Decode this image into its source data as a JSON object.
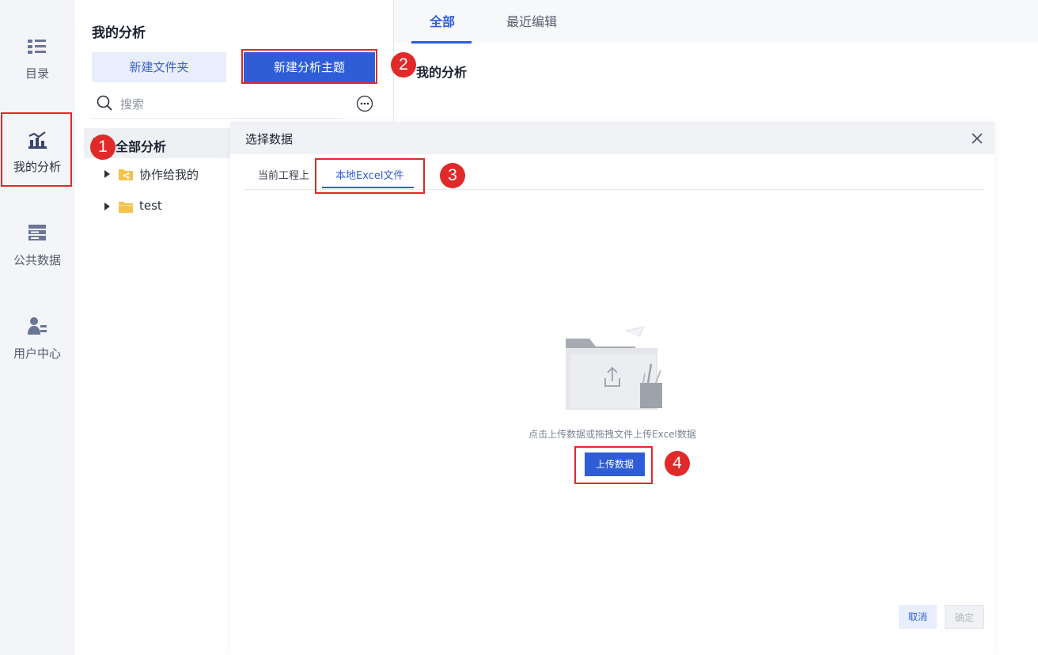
{
  "nav": {
    "items": [
      {
        "label": "目录",
        "icon": "catalog-icon"
      },
      {
        "label": "我的分析",
        "icon": "analysis-chart-icon"
      },
      {
        "label": "公共数据",
        "icon": "public-data-icon"
      },
      {
        "label": "用户中心",
        "icon": "user-center-icon"
      }
    ]
  },
  "sidebar": {
    "title": "我的分析",
    "new_folder_label": "新建文件夹",
    "new_theme_label": "新建分析主题",
    "search_placeholder": "搜索",
    "tree_root": "全部分析",
    "tree_items": [
      {
        "label": "协作给我的",
        "icon": "shared-folder-icon"
      },
      {
        "label": "test",
        "icon": "folder-icon"
      }
    ]
  },
  "main": {
    "tabs": [
      {
        "label": "全部"
      },
      {
        "label": "最近编辑"
      }
    ],
    "section_title": "我的分析"
  },
  "dialog": {
    "title": "选择数据",
    "tabs": [
      {
        "label": "当前工程上"
      },
      {
        "label": "本地Excel文件"
      }
    ],
    "hint": "点击上传数据或拖拽文件上传Excel数据",
    "upload_label": "上传数据",
    "cancel_label": "取消",
    "ok_label": "确定"
  },
  "steps": [
    "1",
    "2",
    "3",
    "4"
  ],
  "colors": {
    "accent": "#2f5dd8",
    "highlight": "#e02a2a"
  }
}
